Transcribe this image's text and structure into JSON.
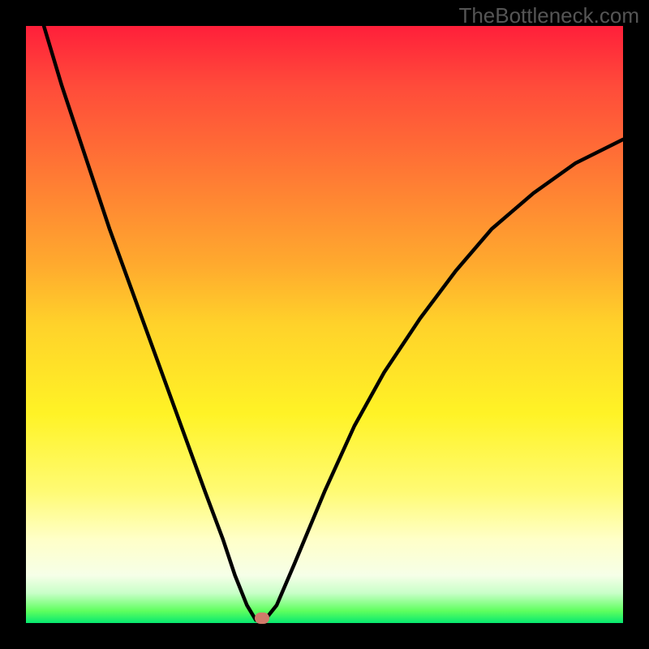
{
  "watermark": "TheBottleneck.com",
  "chart_data": {
    "type": "line",
    "title": "",
    "xlabel": "",
    "ylabel": "",
    "xlim": [
      0,
      100
    ],
    "ylim": [
      0,
      100
    ],
    "gradient_stops": [
      {
        "pos": 0,
        "color": "#ff1f3a"
      },
      {
        "pos": 50,
        "color": "#ffd22a"
      },
      {
        "pos": 80,
        "color": "#ffffc8"
      },
      {
        "pos": 100,
        "color": "#06e870"
      }
    ],
    "series": [
      {
        "name": "bottleneck-curve",
        "x": [
          3,
          6,
          10,
          14,
          18,
          22,
          26,
          30,
          33,
          35,
          37,
          38.5,
          40,
          42,
          45,
          50,
          55,
          60,
          66,
          72,
          78,
          85,
          92,
          100
        ],
        "y": [
          100,
          90,
          78,
          66,
          55,
          44,
          33,
          22,
          14,
          8,
          3,
          0.5,
          0.5,
          3,
          10,
          22,
          33,
          42,
          51,
          59,
          66,
          72,
          77,
          81
        ]
      }
    ],
    "marker": {
      "x": 39.5,
      "y": 0.8,
      "color": "#d07a6a"
    },
    "annotations": []
  }
}
